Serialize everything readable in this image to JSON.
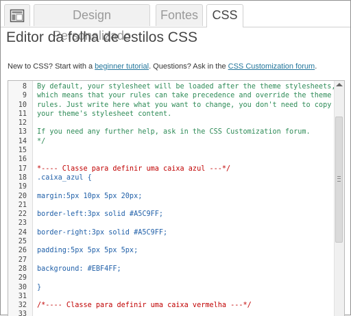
{
  "tabs": [
    {
      "label": "Design Personalizado"
    },
    {
      "label": "Fontes"
    },
    {
      "label": "CSS"
    }
  ],
  "page_title": "Editor da folha de estilos CSS",
  "intro": {
    "text1": "New to CSS? Start with a ",
    "link1": "beginner tutorial",
    "text2": ". Questions? Ask in the ",
    "link2": "CSS Customization forum",
    "text3": "."
  },
  "editor": {
    "lines": [
      {
        "num": "8",
        "text": "By default, your stylesheet will be loaded after the theme stylesheets,",
        "style": "c"
      },
      {
        "num": "9",
        "text": "which means that your rules can take precedence and override the theme CSS",
        "style": "c"
      },
      {
        "num": "10",
        "text": "rules. Just write here what you want to change, you don't need to copy all",
        "style": "c"
      },
      {
        "num": "11",
        "text": "your theme's stylesheet content.",
        "style": "c"
      },
      {
        "num": "12",
        "text": "",
        "style": "c"
      },
      {
        "num": "13",
        "text": "If you need any further help, ask in the CSS Customization forum.",
        "style": "c"
      },
      {
        "num": "14",
        "text": "*/",
        "style": "c"
      },
      {
        "num": "15",
        "text": "",
        "style": "c"
      },
      {
        "num": "16",
        "text": "",
        "style": "c"
      },
      {
        "num": "17",
        "text": "*---- Classe para definir uma caixa azul ---*/",
        "style": "r"
      },
      {
        "num": "18",
        "text": ".caixa_azul {",
        "style": "k"
      },
      {
        "num": "19",
        "text": "",
        "style": "k"
      },
      {
        "num": "20",
        "text": "margin:5px 10px 5px 20px;",
        "style": "k"
      },
      {
        "num": "21",
        "text": "",
        "style": "k"
      },
      {
        "num": "22",
        "text": "border-left:3px solid #A5C9FF;",
        "style": "k"
      },
      {
        "num": "23",
        "text": "",
        "style": "k"
      },
      {
        "num": "24",
        "text": "border-right:3px solid #A5C9FF;",
        "style": "k"
      },
      {
        "num": "25",
        "text": "",
        "style": "k"
      },
      {
        "num": "26",
        "text": "padding:5px 5px 5px 5px;",
        "style": "k"
      },
      {
        "num": "27",
        "text": "",
        "style": "k"
      },
      {
        "num": "28",
        "text": "background: #EBF4FF;",
        "style": "k"
      },
      {
        "num": "29",
        "text": "",
        "style": "k"
      },
      {
        "num": "30",
        "text": "}",
        "style": "k"
      },
      {
        "num": "31",
        "text": "",
        "style": "k"
      },
      {
        "num": "32",
        "text": "/*---- Classe para definir uma caixa vermelha ---*/",
        "style": "r"
      },
      {
        "num": "33",
        "text": "",
        "style": "k"
      }
    ]
  }
}
